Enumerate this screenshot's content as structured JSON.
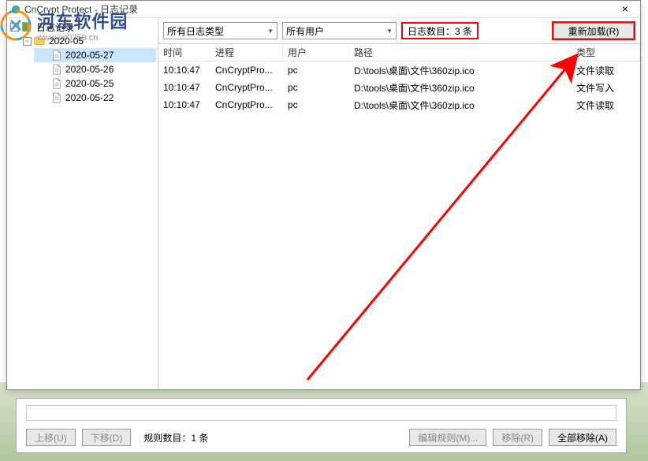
{
  "watermark": {
    "cn": "河东软件园",
    "url": "www.pc0359.cn"
  },
  "window": {
    "title": "CnCrypt Protect - 日志记录",
    "close": "×"
  },
  "tree": {
    "root_label": "日志记录",
    "folder": "2020-05",
    "dates": [
      "2020-05-27",
      "2020-05-26",
      "2020-05-25",
      "2020-05-22"
    ],
    "selected_index": 0
  },
  "toolbar": {
    "log_type_combo": "所有日志类型",
    "user_combo": "所有用户",
    "count_label": "日志数目：3 条",
    "reload_btn": "重新加载(R)"
  },
  "table": {
    "headers": {
      "time": "时间",
      "process": "进程",
      "user": "用户",
      "path": "路径",
      "type": "类型"
    },
    "rows": [
      {
        "time": "10:10:47",
        "process": "CnCryptPro...",
        "user": "pc",
        "path": "D:\\tools\\桌面\\文件\\360zip.ico",
        "type": "文件读取"
      },
      {
        "time": "10:10:47",
        "process": "CnCryptPro...",
        "user": "pc",
        "path": "D:\\tools\\桌面\\文件\\360zip.ico",
        "type": "文件写入"
      },
      {
        "time": "10:10:47",
        "process": "CnCryptPro...",
        "user": "pc",
        "path": "D:\\tools\\桌面\\文件\\360zip.ico",
        "type": "文件读取"
      }
    ]
  },
  "bottom": {
    "move_up": "上移(U)",
    "move_down": "下移(D)",
    "rule_count": "规则数目：1 条",
    "edit_rule": "编辑规则(M)...",
    "remove": "移除(R)",
    "remove_all": "全部移除(A)"
  }
}
